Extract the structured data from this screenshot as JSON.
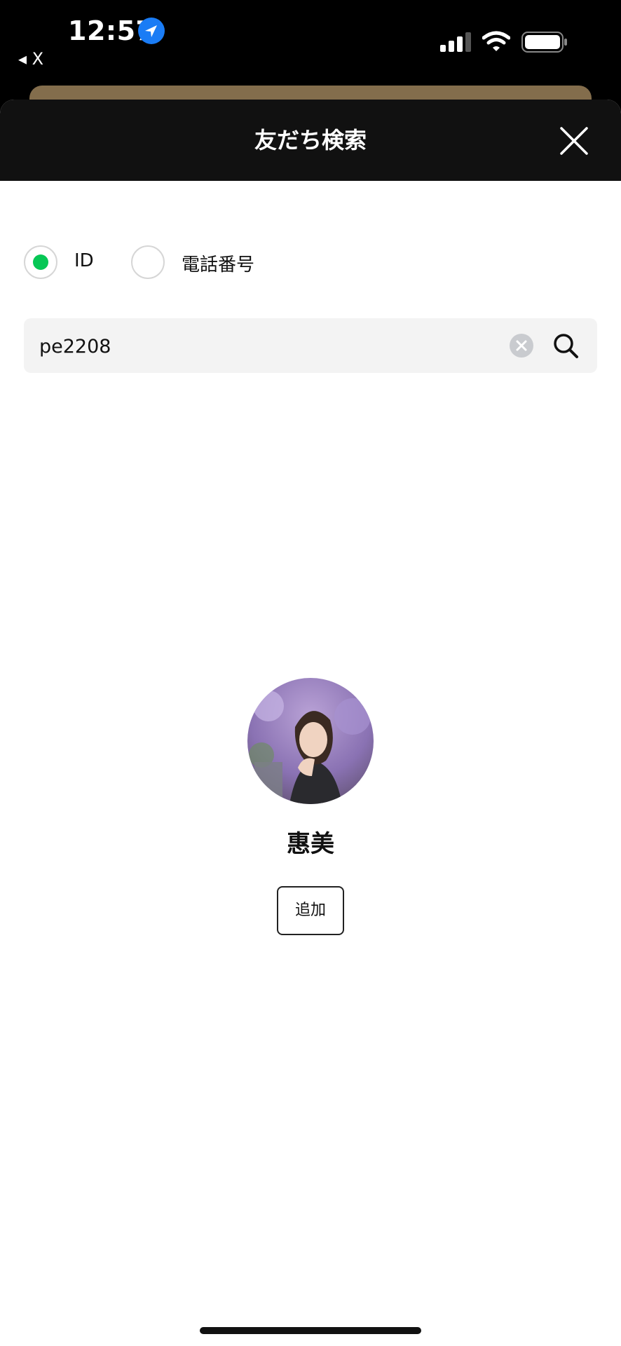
{
  "status_bar": {
    "time": "12:57",
    "back_app_label": "◂ X",
    "icons": [
      "location-arrow-icon",
      "signal-icon",
      "wifi-icon",
      "battery-icon"
    ]
  },
  "header": {
    "title": "友だち検索",
    "close_icon": "close-icon"
  },
  "search_type": {
    "options": [
      {
        "label": "ID",
        "selected": true
      },
      {
        "label": "電話番号",
        "selected": false
      }
    ],
    "selected_color": "#06c755"
  },
  "search": {
    "value": "pe2208",
    "clear_icon": "clear-icon",
    "search_icon": "search-icon"
  },
  "result": {
    "name": "惠美",
    "add_label": "追加",
    "avatar": "profile-photo"
  },
  "colors": {
    "accent": "#06c755",
    "header_bg": "#111111",
    "peek_card": "#8a7350"
  }
}
